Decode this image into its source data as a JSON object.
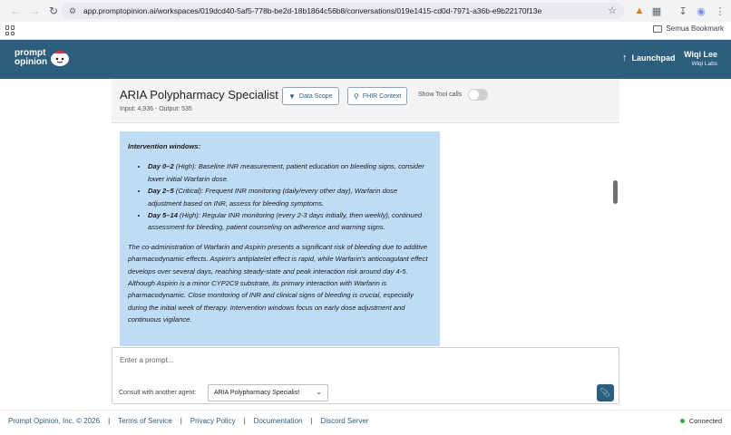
{
  "browser": {
    "url": "app.promptopinion.ai/workspaces/019dcd40-5af5-778b-be2d-18b1864c56b8/conversations/019e1415-cd0d-7971-a36b-e9b22170f13e",
    "bookmark_folder": "Semua Bookmark"
  },
  "header": {
    "logo_line1": "prompt",
    "logo_line2": "opinion",
    "launchpad_label": "Launchpad",
    "user_name": "Wiqi Lee",
    "user_org": "Wiqi Labs"
  },
  "agent_panel": {
    "title": "ARIA Polypharmacy Specialist",
    "data_scope_label": "Data Scope",
    "fhir_context_label": "FHIR Context",
    "show_tool_calls_label": "Show Tool calls",
    "usage": "Input: 4,936 - Output: 535"
  },
  "message": {
    "heading": "Intervention windows:",
    "items": [
      {
        "label": "Day 0–2",
        "text": " (High): Baseline INR measurement, patient education on bleeding signs, consider lower initial Warfarin dose."
      },
      {
        "label": "Day 2–5",
        "text": " (Critical): Frequent INR monitoring (daily/every other day), Warfarin dose adjustment based on INR, assess for bleeding symptoms."
      },
      {
        "label": "Day 5–14",
        "text": " (High): Regular INR monitoring (every 2-3 days initially, then weekly), continued assessment for bleeding, patient counseling on adherence and warning signs."
      }
    ],
    "paragraph": "The co-administration of Warfarin and Aspirin presents a significant risk of bleeding due to additive pharmacodynamic effects. Aspirin's antiplatelet effect is rapid, while Warfarin's anticoagulant effect develops over several days, reaching steady-state and peak interaction risk around day 4-5. Although Aspirin is a minor CYP2C9 substrate, its primary interaction with Warfarin is pharmacodynamic. Close monitoring of INR and clinical signs of bleeding is crucial, especially during the initial week of therapy. Intervention windows focus on early dose adjustment and continuous vigilance."
  },
  "composer": {
    "placeholder": "Enter a prompt...",
    "consult_label": "Consult with another agent:",
    "selected_agent": "ARIA Polypharmacy Specialist"
  },
  "footer": {
    "copyright": "Prompt Opinion, Inc. © 2026",
    "links": [
      "Terms of Service",
      "Privacy Policy",
      "Documentation",
      "Discord Server"
    ],
    "status": "Connected",
    "status_color": "#2dad4a"
  },
  "colors": {
    "brand": "#2e5e7e",
    "bubble": "#bfdcf6"
  }
}
